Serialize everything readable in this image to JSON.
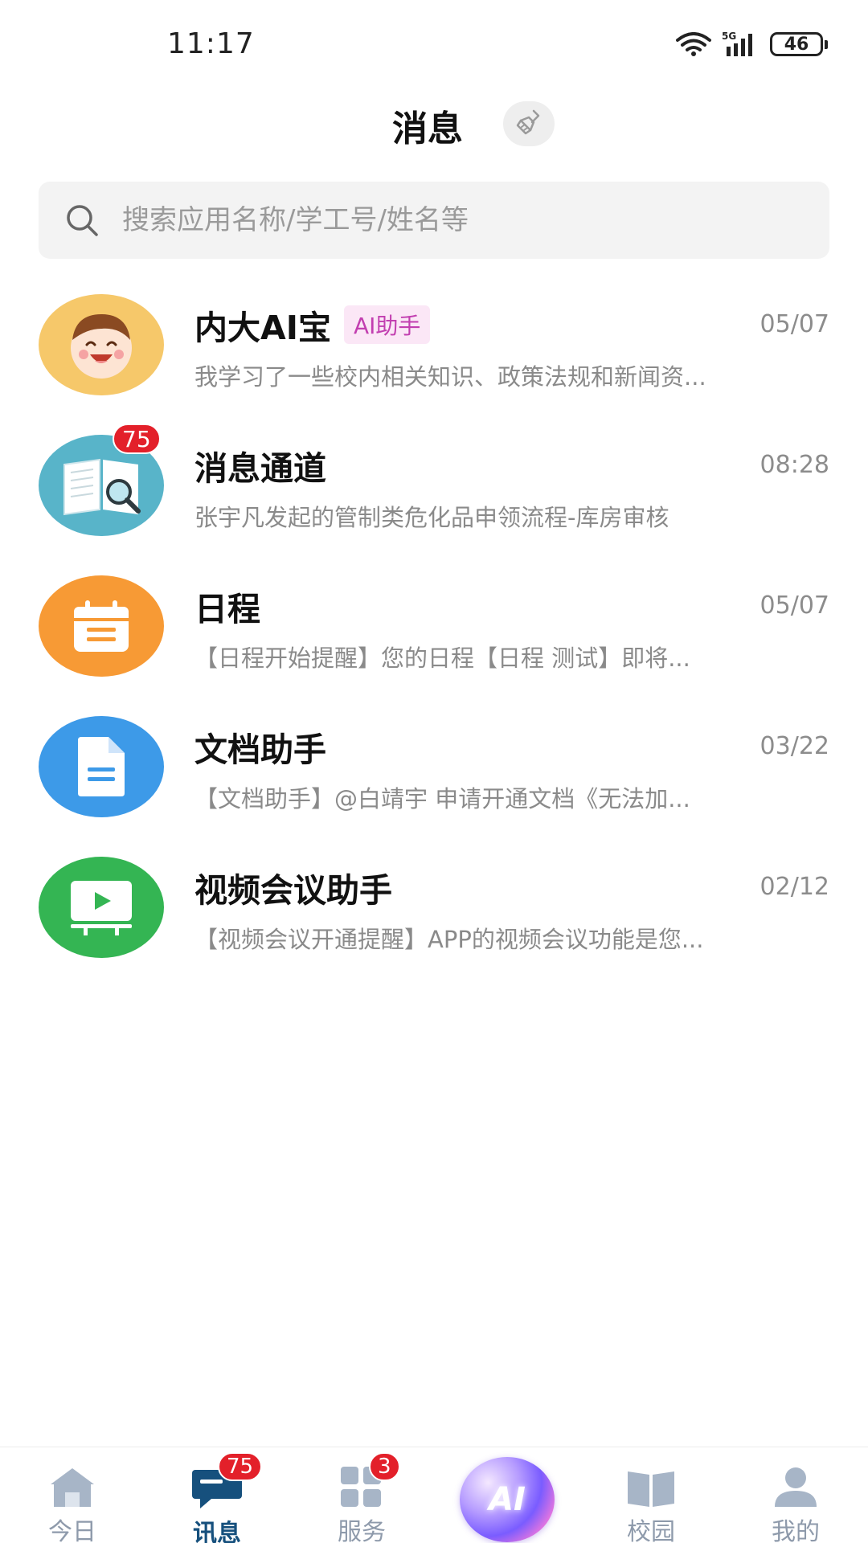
{
  "status_bar": {
    "time": "11:17",
    "network": "5G",
    "battery": "46"
  },
  "header": {
    "title": "消息",
    "clear_icon": "broom-icon"
  },
  "search": {
    "placeholder": "搜索应用名称/学工号/姓名等",
    "icon": "search-icon"
  },
  "conversations": [
    {
      "name": "内大AI宝",
      "tag": "AI助手",
      "time": "05/07",
      "preview": "我学习了一些校内相关知识、政策法规和新闻资...",
      "avatar": "smiling-face-avatar",
      "avatar_color": "#f6c86a"
    },
    {
      "name": "消息通道",
      "time": "08:28",
      "preview": "张宇凡发起的管制类危化品申领流程-库房审核",
      "badge": "75",
      "avatar": "book-magnifier-icon",
      "avatar_color": "#58b4c9"
    },
    {
      "name": "日程",
      "time": "05/07",
      "preview": "【日程开始提醒】您的日程【日程 测试】即将...",
      "avatar": "calendar-icon",
      "avatar_color": "#f79a35"
    },
    {
      "name": "文档助手",
      "time": "03/22",
      "preview": "【文档助手】@白靖宇 申请开通文档《无法加...",
      "avatar": "document-icon",
      "avatar_color": "#3d9ae8"
    },
    {
      "name": "视频会议助手",
      "time": "02/12",
      "preview": "【视频会议开通提醒】APP的视频会议功能是您...",
      "avatar": "video-screen-icon",
      "avatar_color": "#34b553"
    }
  ],
  "bottom_nav": {
    "items": [
      {
        "label": "今日",
        "icon": "home-icon"
      },
      {
        "label": "讯息",
        "icon": "chat-icon",
        "badge": "75",
        "active": true
      },
      {
        "label": "服务",
        "icon": "grid-icon",
        "badge": "3"
      },
      {
        "label": "",
        "icon": "ai-orb-icon",
        "orb_text": "AI"
      },
      {
        "label": "校园",
        "icon": "open-book-icon"
      },
      {
        "label": "我的",
        "icon": "person-icon"
      }
    ],
    "active_color": "#16507d",
    "inactive_color": "#8e9aab"
  }
}
